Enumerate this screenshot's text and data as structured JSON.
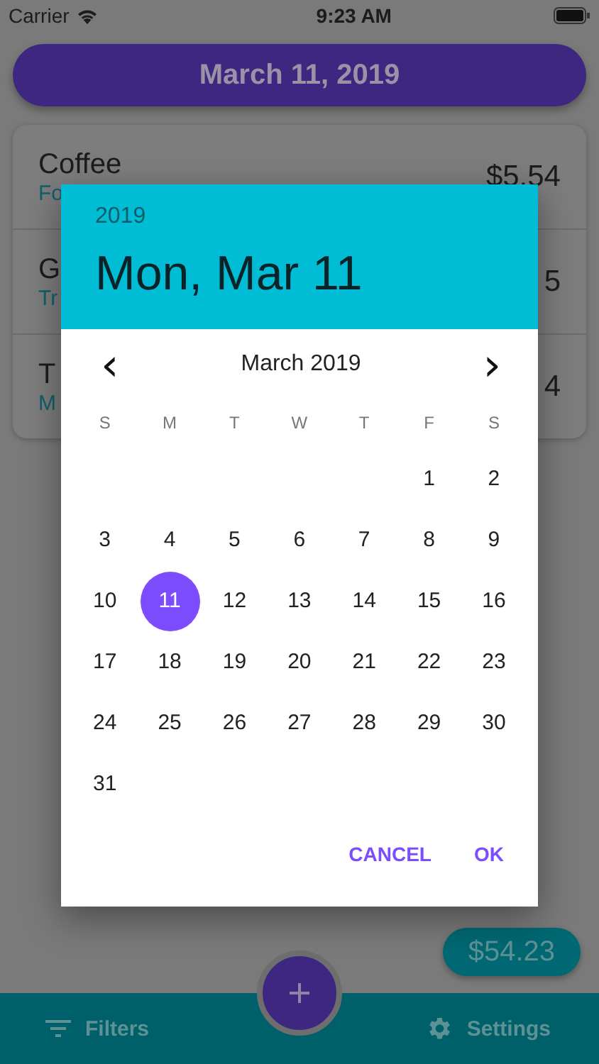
{
  "status_bar": {
    "carrier": "Carrier",
    "time": "9:23 AM"
  },
  "date_button": "March 11, 2019",
  "expenses": [
    {
      "title": "Coffee",
      "category": "Fo",
      "amount": "$5.54"
    },
    {
      "title": "G",
      "category": "Tr",
      "amount": "5"
    },
    {
      "title": "T",
      "category": "M",
      "amount": "4"
    }
  ],
  "total": "$54.23",
  "bottom_bar": {
    "filters": "Filters",
    "settings": "Settings"
  },
  "date_picker": {
    "year": "2019",
    "date": "Mon, Mar 11",
    "month": "March 2019",
    "prev": "‹",
    "next": "›",
    "weekdays": [
      "S",
      "M",
      "T",
      "W",
      "T",
      "F",
      "S"
    ],
    "days": [
      {
        "kind": "blank"
      },
      {
        "kind": "blank"
      },
      {
        "kind": "blank"
      },
      {
        "kind": "blank"
      },
      {
        "kind": "blank"
      },
      {
        "kind": "day",
        "label": "1",
        "selected": false
      },
      {
        "kind": "day",
        "label": "2",
        "selected": false
      },
      {
        "kind": "day",
        "label": "3",
        "selected": false
      },
      {
        "kind": "day",
        "label": "4",
        "selected": false
      },
      {
        "kind": "day",
        "label": "5",
        "selected": false
      },
      {
        "kind": "day",
        "label": "6",
        "selected": false
      },
      {
        "kind": "day",
        "label": "7",
        "selected": false
      },
      {
        "kind": "day",
        "label": "8",
        "selected": false
      },
      {
        "kind": "day",
        "label": "9",
        "selected": false
      },
      {
        "kind": "day",
        "label": "10",
        "selected": false
      },
      {
        "kind": "day",
        "label": "11",
        "selected": true
      },
      {
        "kind": "day",
        "label": "12",
        "selected": false
      },
      {
        "kind": "day",
        "label": "13",
        "selected": false
      },
      {
        "kind": "day",
        "label": "14",
        "selected": false
      },
      {
        "kind": "day",
        "label": "15",
        "selected": false
      },
      {
        "kind": "day",
        "label": "16",
        "selected": false
      },
      {
        "kind": "day",
        "label": "17",
        "selected": false
      },
      {
        "kind": "day",
        "label": "18",
        "selected": false
      },
      {
        "kind": "day",
        "label": "19",
        "selected": false
      },
      {
        "kind": "day",
        "label": "20",
        "selected": false
      },
      {
        "kind": "day",
        "label": "21",
        "selected": false
      },
      {
        "kind": "day",
        "label": "22",
        "selected": false
      },
      {
        "kind": "day",
        "label": "23",
        "selected": false
      },
      {
        "kind": "day",
        "label": "24",
        "selected": false
      },
      {
        "kind": "day",
        "label": "25",
        "selected": false
      },
      {
        "kind": "day",
        "label": "26",
        "selected": false
      },
      {
        "kind": "day",
        "label": "27",
        "selected": false
      },
      {
        "kind": "day",
        "label": "28",
        "selected": false
      },
      {
        "kind": "day",
        "label": "29",
        "selected": false
      },
      {
        "kind": "day",
        "label": "30",
        "selected": false
      },
      {
        "kind": "day",
        "label": "31",
        "selected": false
      }
    ],
    "buttons": [
      "CANCEL",
      "OK"
    ]
  }
}
